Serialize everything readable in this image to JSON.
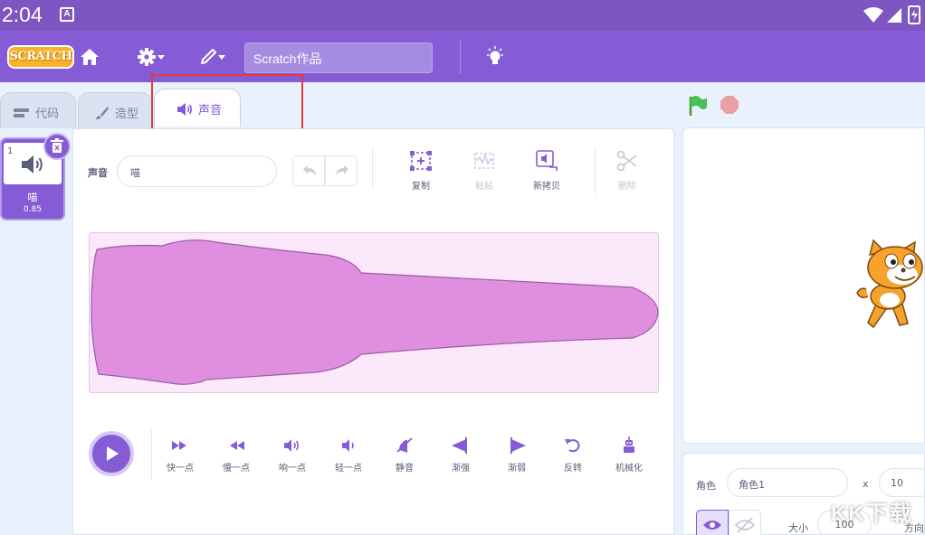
{
  "status_bar": {
    "time": "2:04",
    "notification_icon": "A"
  },
  "menu": {
    "logo_text": "SCRATCH",
    "project_title": "Scratch作品",
    "icons": [
      "home-icon",
      "gear-icon",
      "pencil-icon",
      "lightbulb-icon"
    ]
  },
  "tabs": [
    {
      "label": "代码",
      "icon": "code-blocks-icon"
    },
    {
      "label": "造型",
      "icon": "brush-icon"
    },
    {
      "label": "声音",
      "icon": "speaker-icon",
      "active": true
    }
  ],
  "sound_list": [
    {
      "index": "1",
      "name": "喵",
      "duration": "0.85"
    }
  ],
  "editor": {
    "name_label": "声音",
    "name_value": "喵",
    "tools": [
      {
        "label": "复制",
        "enabled": true
      },
      {
        "label": "粘贴",
        "enabled": false
      },
      {
        "label": "新拷贝",
        "enabled": true
      },
      {
        "label": "删除",
        "enabled": false
      }
    ],
    "effects": [
      "快一点",
      "慢一点",
      "响一点",
      "轻一点",
      "静音",
      "渐强",
      "渐弱",
      "反转",
      "机械化"
    ]
  },
  "sprite_info": {
    "sprite_label": "角色",
    "sprite_name": "角色1",
    "x_label": "x",
    "x_value": "10",
    "size_label": "大小",
    "size_value": "100",
    "direction_label": "方向"
  },
  "colors": {
    "accent": "#855cd6",
    "status_bar": "#7d56c2",
    "waveform": "#e08fe0",
    "highlight_box": "#e03b3b",
    "flag": "#4cbf56",
    "stop": "#ec5959"
  },
  "watermark": "KK下载"
}
